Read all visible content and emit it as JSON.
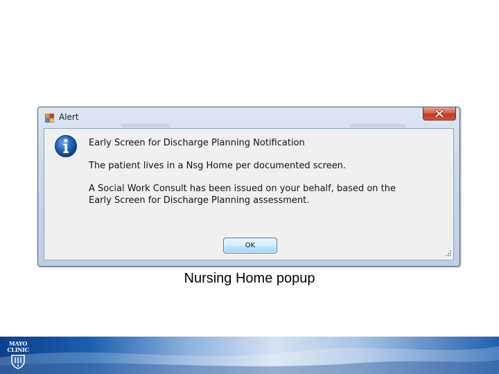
{
  "window": {
    "title": "Alert",
    "message_heading": "Early Screen for Discharge Planning Notification",
    "message_line1": "The patient lives in a Nsg Home per documented screen.",
    "message_line2a": "A Social Work Consult has been issued on your behalf, based on the",
    "message_line2b": "Early Screen for Discharge Planning assessment.",
    "ok_label": "OK",
    "icons": {
      "app": "app-icon",
      "close": "close-icon",
      "info": "info-icon",
      "grip": "resize-grip-icon"
    }
  },
  "caption": "Nursing Home popup",
  "footer": {
    "logo_line1": "MAYO",
    "logo_line2": "CLINIC",
    "logo_icon": "mayo-shield-icon"
  },
  "colors": {
    "close_button": "#c0391f",
    "ok_border": "#3c7fb1",
    "footer_dark": "#0b3f8c",
    "info_blue": "#1f5fb4"
  }
}
